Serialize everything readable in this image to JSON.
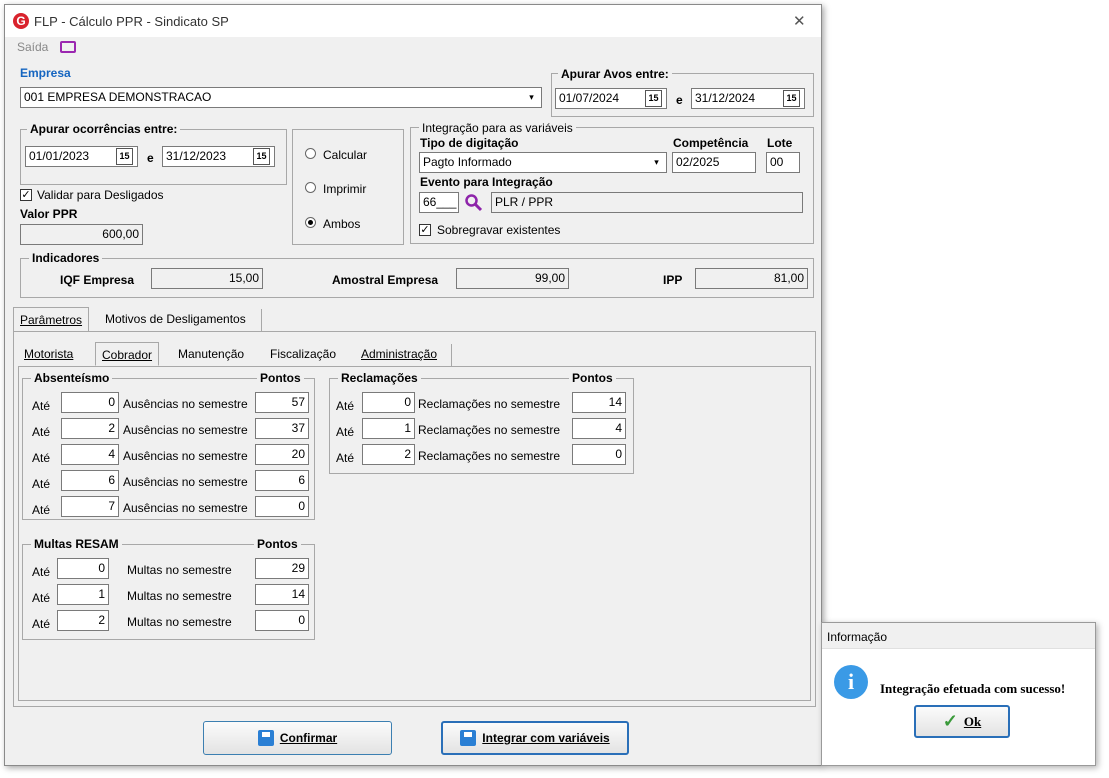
{
  "window": {
    "title": "FLP - Cálculo PPR - Sindicato SP",
    "menu_exit": "Saída",
    "close": "✕"
  },
  "empresa": {
    "label": "Empresa",
    "value": "001 EMPRESA DEMONSTRACAO"
  },
  "avos": {
    "label": "Apurar Avos entre:",
    "from": "01/07/2024",
    "sep": "e",
    "to": "31/12/2024"
  },
  "ocorrencias": {
    "label": "Apurar ocorrências entre:",
    "from": "01/01/2023",
    "sep": "e",
    "to": "31/12/2023"
  },
  "calendar_glyph": "15",
  "dropdown_glyph": "▾",
  "validar": {
    "label": "Validar para Desligados",
    "checked": true
  },
  "valor_ppr": {
    "label": "Valor PPR",
    "value": "600,00"
  },
  "modo": {
    "calcular": "Calcular",
    "imprimir": "Imprimir",
    "ambos": "Ambos",
    "selected": "Ambos"
  },
  "integracao": {
    "group_label": "Integração para as variáveis",
    "tipo_label": "Tipo de digitação",
    "tipo_value": "Pagto Informado",
    "competencia_label": "Competência",
    "competencia_value": "02/2025",
    "lote_label": "Lote",
    "lote_value": "00",
    "evento_label": "Evento para Integração",
    "evento_code": "66___",
    "evento_desc": "PLR / PPR",
    "sobregravar_label": "Sobregravar existentes",
    "sobregravar_checked": true
  },
  "indicadores": {
    "label": "Indicadores",
    "iqf_label": "IQF Empresa",
    "iqf_value": "15,00",
    "amostral_label": "Amostral Empresa",
    "amostral_value": "99,00",
    "ipp_label": "IPP",
    "ipp_value": "81,00"
  },
  "main_tabs": [
    "Parâmetros",
    "Motivos de Desligamentos"
  ],
  "sub_tabs": [
    "Motorista",
    "Cobrador",
    "Manutenção",
    "Fiscalização",
    "Administração"
  ],
  "ate": "Até",
  "absenteismo": {
    "label": "Absenteísmo",
    "pontos_label": "Pontos",
    "desc": "Ausências no semestre",
    "rows": [
      {
        "ate": "0",
        "pontos": "57"
      },
      {
        "ate": "2",
        "pontos": "37"
      },
      {
        "ate": "4",
        "pontos": "20"
      },
      {
        "ate": "6",
        "pontos": "6"
      },
      {
        "ate": "7",
        "pontos": "0"
      }
    ]
  },
  "reclamacoes": {
    "label": "Reclamações",
    "pontos_label": "Pontos",
    "desc": "Reclamações no semestre",
    "rows": [
      {
        "ate": "0",
        "pontos": "14"
      },
      {
        "ate": "1",
        "pontos": "4"
      },
      {
        "ate": "2",
        "pontos": "0"
      }
    ]
  },
  "multas": {
    "label": "Multas RESAM",
    "pontos_label": "Pontos",
    "desc": "Multas no semestre",
    "rows": [
      {
        "ate": "0",
        "pontos": "29"
      },
      {
        "ate": "1",
        "pontos": "14"
      },
      {
        "ate": "2",
        "pontos": "0"
      }
    ]
  },
  "buttons": {
    "confirmar": "Confirmar",
    "integrar": "Integrar com variáveis"
  },
  "dialog": {
    "title": "Informação",
    "message": "Integração efetuada com sucesso!",
    "icon": "i",
    "ok_check": "✓",
    "ok": "Ok"
  },
  "colors": {
    "accent": "#2a7fd4",
    "logo": "#d9232d",
    "exit_icon": "#9b27b0",
    "link_blue": "#1565c0"
  }
}
